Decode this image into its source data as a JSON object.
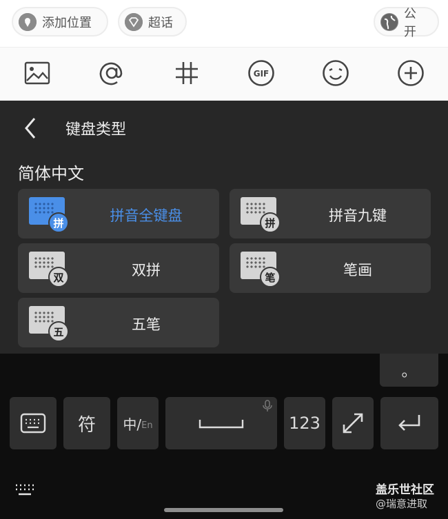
{
  "composer": {
    "chips": {
      "location": "添加位置",
      "topic": "超话",
      "visibility": "公开"
    },
    "toolbar_icons": [
      "image-icon",
      "at-icon",
      "hashtag-icon",
      "gif-icon",
      "emoji-icon",
      "add-icon"
    ]
  },
  "keyboard_panel": {
    "title": "键盘类型",
    "section": "简体中文",
    "options": [
      {
        "label": "拼音全键盘",
        "badge": "拼",
        "selected": true
      },
      {
        "label": "拼音九键",
        "badge": "拼",
        "selected": false
      },
      {
        "label": "双拼",
        "badge": "双",
        "selected": false
      },
      {
        "label": "笔画",
        "badge": "笔",
        "selected": false
      },
      {
        "label": "五笔",
        "badge": "五",
        "selected": false
      }
    ]
  },
  "keys": {
    "period": "。",
    "symbol": "符",
    "lang_zh": "中/",
    "lang_en": "En",
    "numbers": "123"
  },
  "watermark": {
    "title": "盖乐世社区",
    "sub": "@瑞意进取"
  },
  "colors": {
    "accent": "#4a8fe8",
    "panel_bg": "#272727",
    "option_bg": "#393939"
  }
}
